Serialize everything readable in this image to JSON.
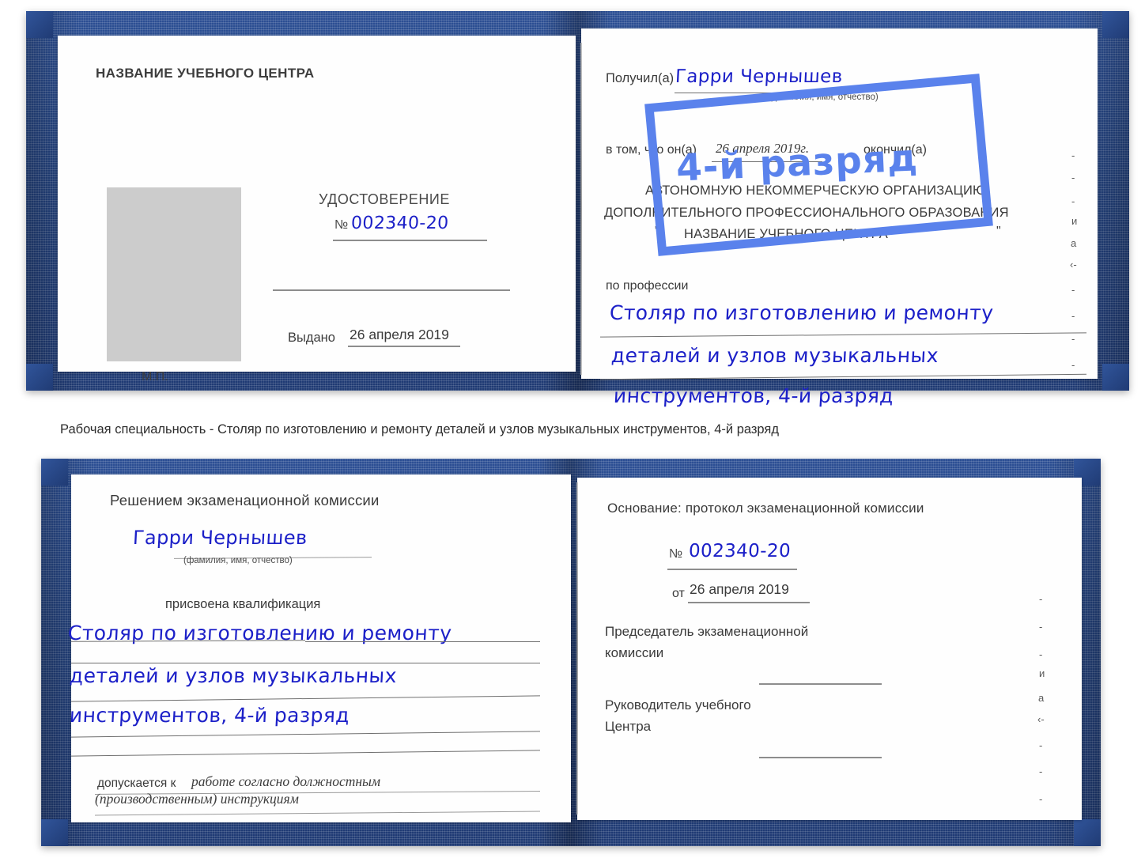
{
  "document": {
    "type": "certificate-booklet-scan",
    "language": "ru",
    "caption": "Рабочая специальность - Столяр по изготовлению и ремонту деталей и узлов музыкальных инструментов, 4-й разряд"
  },
  "colors": {
    "cover_blue": "#24437f",
    "stamp_blue": "#5a82ec",
    "handwriting_blue": "#1c20c8",
    "photo_placeholder": "#cccccc",
    "rule_gray": "#8d8d8d"
  },
  "certificate_top": {
    "left_page": {
      "header": "НАЗВАНИЕ УЧЕБНОГО ЦЕНТРА",
      "title": "УДОСТОВЕРЕНИЕ",
      "number_symbol": "№",
      "number_value": "002340-20",
      "issued_label": "Выдано",
      "issued_value": "26 апреля 2019",
      "seal_label": "М.П."
    },
    "right_page": {
      "received_label": "Получил(а)",
      "received_name": "Гарри Чернышев",
      "name_hint": "(фамилия, имя, отчество)",
      "in_that_label": "в том, что он(а)",
      "completion_date": "26 апреля 2019г.",
      "finished_label": "окончил(а)",
      "org_line1": "АВТОНОМНУЮ НЕКОММЕРЧЕСКУЮ ОРГАНИЗАЦИЮ",
      "org_line2": "ДОПОЛНИТЕЛЬНОГО ПРОФЕССИОНАЛЬНОГО ОБРАЗОВАНИЯ",
      "org_quote_open": "\"",
      "org_name": "НАЗВАНИЕ УЧЕБНОГО ЦЕНТРА",
      "org_quote_close": "\"",
      "profession_label": "по профессии",
      "profession_line1": "Столяр по изготовлению и ремонту",
      "profession_line2": "деталей и узлов музыкальных",
      "profession_line3": "инструментов, 4-й разряд",
      "stamp_text": "4-й разряд",
      "edge_marks": [
        "-",
        "-",
        "-",
        "и",
        "а",
        "‹-",
        "-",
        "-",
        "-",
        "-"
      ]
    }
  },
  "certificate_bottom": {
    "left_page": {
      "header": "Решением экзаменационной комиссии",
      "name": "Гарри Чернышев",
      "name_hint": "(фамилия, имя, отчество)",
      "qualification_label": "присвоена квалификация",
      "qualification_line1": "Столяр по изготовлению и ремонту",
      "qualification_line2": "деталей и узлов музыкальных",
      "qualification_line3": "инструментов, 4-й разряд",
      "admitted_label": "допускается к",
      "admitted_value_line1": "работе согласно должностным",
      "admitted_value_line2": "(производственным) инструкциям"
    },
    "right_page": {
      "basis_label": "Основание: протокол экзаменационной комиссии",
      "number_symbol": "№",
      "number_value": "002340-20",
      "from_label": "от",
      "from_value": "26 апреля 2019",
      "chairman_line1": "Председатель экзаменационной",
      "chairman_line2": "комиссии",
      "head_line1": "Руководитель учебного",
      "head_line2": "Центра",
      "edge_marks": [
        "-",
        "-",
        "-",
        "и",
        "а",
        "‹-",
        "-",
        "-",
        "-"
      ]
    }
  }
}
